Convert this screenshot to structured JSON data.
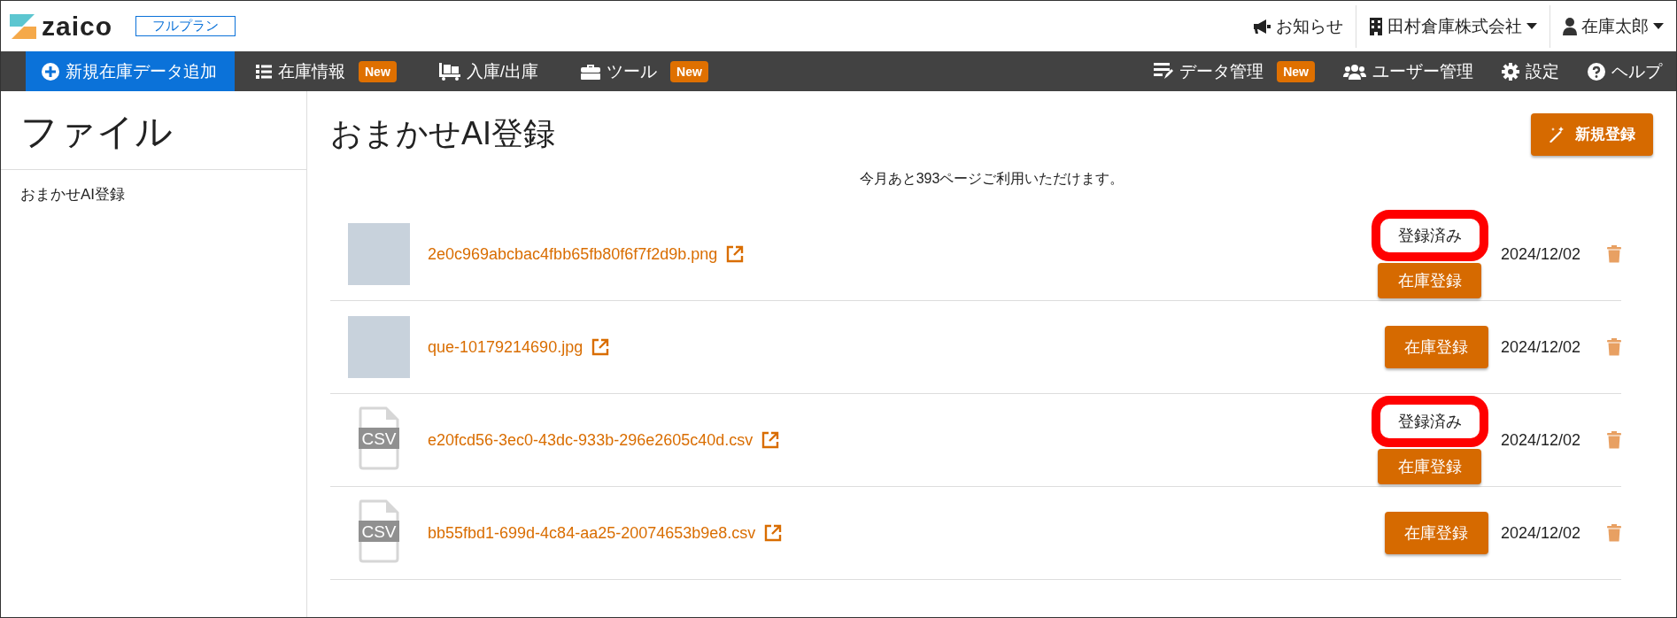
{
  "header": {
    "logo": "zaico",
    "plan": "フルプラン",
    "links": [
      {
        "label": "お知らせ",
        "dropdown": false
      },
      {
        "label": "田村倉庫株式会社",
        "dropdown": true
      },
      {
        "label": "在庫太郎",
        "dropdown": true
      }
    ]
  },
  "nav": {
    "left": [
      {
        "label": "新規在庫データ追加",
        "primary": true
      },
      {
        "label": "在庫情報",
        "primary": false,
        "badge": "New"
      },
      {
        "label": "入庫/出庫",
        "primary": false
      },
      {
        "label": "ツール",
        "primary": false,
        "badge": "New"
      }
    ],
    "right": [
      {
        "label": "データ管理",
        "badge": "New"
      },
      {
        "label": "ユーザー管理"
      },
      {
        "label": "設定"
      },
      {
        "label": "ヘルプ"
      }
    ]
  },
  "sidebar": {
    "title": "ファイル",
    "items": [
      {
        "label": "おまかせAI登録"
      }
    ]
  },
  "main": {
    "title": "おまかせAI登録",
    "new_button": "新規登録",
    "notice": "今月あと393ページご利用いただけます。",
    "files": [
      {
        "kind": "image",
        "name": "2e0c969abcbac4fbb65fb80f6f7f2d9b.png",
        "tag": "登録済み",
        "button": "在庫登録",
        "date": "2024/12/02"
      },
      {
        "kind": "image",
        "name": "que-10179214690.jpg",
        "button": "在庫登録",
        "date": "2024/12/02"
      },
      {
        "kind": "csv",
        "file_label": "CSV",
        "name": "e20fcd56-3ec0-43dc-933b-296e2605c40d.csv",
        "tag": "登録済み",
        "button": "在庫登録",
        "date": "2024/12/02"
      },
      {
        "kind": "csv",
        "file_label": "CSV",
        "name": "bb55fbd1-699d-4c84-aa25-20074653b9e8.csv",
        "button": "在庫登録",
        "date": "2024/12/02"
      }
    ]
  }
}
